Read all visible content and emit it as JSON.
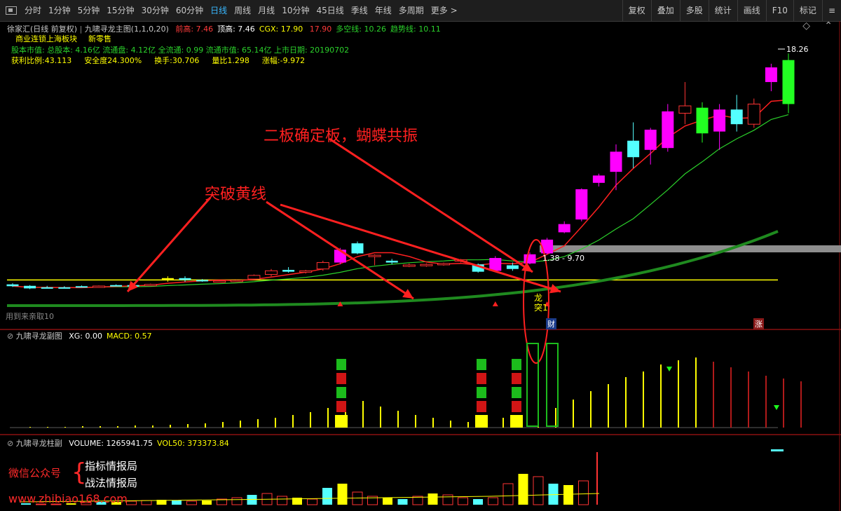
{
  "toolbar": {
    "items": [
      "分时",
      "1分钟",
      "5分钟",
      "15分钟",
      "30分钟",
      "60分钟",
      "日线",
      "周线",
      "月线",
      "10分钟",
      "45日线",
      "季线",
      "年线",
      "多周期",
      "更多 >"
    ],
    "active_index": 6,
    "right_items": [
      "复权",
      "叠加",
      "多股",
      "统计",
      "画线",
      "F10",
      "标记",
      "≡"
    ]
  },
  "main_panel": {
    "header": "徐家汇(日线 前复权)",
    "indicator_name": "九啸寻龙主图(1,1,0,20)",
    "fields": [
      {
        "label": "前高:",
        "value": "7.46",
        "color": "#ff3b3b"
      },
      {
        "label": "顶高:",
        "value": "7.46",
        "color": "#ffffff"
      },
      {
        "label": "CGX:",
        "value": "17.90",
        "color": "#ffff00"
      },
      {
        "label": "",
        "value": "17.90",
        "color": "#ff3b3b"
      },
      {
        "label": "多空线:",
        "value": "10.26",
        "color": "#2bd12b"
      },
      {
        "label": "趋势线:",
        "value": "10.11",
        "color": "#2bd12b"
      }
    ],
    "sector_line": [
      "商业连锁",
      "上海板块",
      "新零售"
    ],
    "stock_info": "股本市值: 总股本: 4.16亿 流通盘: 4.12亿 全流通: 0.99 流通市值: 65.14亿 上市日期: 20190702",
    "stats": [
      {
        "label": "获利比例:",
        "value": "43.113"
      },
      {
        "label": "安全度",
        "value": "24.300%"
      },
      {
        "label": "换手:",
        "value": "30.706"
      },
      {
        "label": "量比",
        "value": "1.298"
      },
      {
        "label": "涨幅:",
        "value": "-9.972"
      }
    ],
    "max_price_label": "18.26",
    "zone_label": "1.38 - 9.70",
    "watermark_text": "用到来亲取10",
    "marker_cai": "财",
    "marker_zhang": "涨",
    "vertical_text": [
      "龙",
      "突1"
    ]
  },
  "annotations": {
    "breakout": "突破黄线",
    "second_board": "二板确定板，蝴蝶共振"
  },
  "sub_panel": {
    "title": "九啸寻龙副图",
    "fields": [
      {
        "label": "XG:",
        "value": "0.00",
        "color": "#ffffff"
      },
      {
        "label": "MACD:",
        "value": "0.57",
        "color": "#ffff00"
      }
    ]
  },
  "volume_panel": {
    "title": "九啸寻龙柱副",
    "fields": [
      {
        "label": "VOLUME:",
        "value": "1265941.75",
        "color": "#ffffff"
      },
      {
        "label": "VOL50:",
        "value": "373373.84",
        "color": "#ffff00"
      }
    ]
  },
  "promo": {
    "account_label": "微信公众号",
    "names": [
      "指标情报局",
      "战法情报局"
    ],
    "url": "www.zhibiao168.com"
  },
  "chart_data": {
    "type": "candlestick",
    "price_range": [
      4.5,
      18.5
    ],
    "max_price": 18.26,
    "yellow_line": 5.9,
    "candles": [
      {
        "o": 5.66,
        "h": 5.72,
        "l": 5.52,
        "c": 5.56,
        "col": "#54ffff"
      },
      {
        "o": 5.58,
        "h": 5.62,
        "l": 5.4,
        "c": 5.44,
        "col": "#54ffff"
      },
      {
        "o": 5.5,
        "h": 5.58,
        "l": 5.44,
        "c": 5.48,
        "col": "#54ffff"
      },
      {
        "o": 5.5,
        "h": 5.56,
        "l": 5.44,
        "c": 5.46,
        "col": "#54ffff"
      },
      {
        "o": 5.56,
        "h": 5.6,
        "l": 5.5,
        "c": 5.54,
        "col": "#54ffff"
      },
      {
        "o": 5.55,
        "h": 5.6,
        "l": 5.52,
        "c": 5.57,
        "col": "#ff3333"
      },
      {
        "o": 5.6,
        "h": 5.66,
        "l": 5.56,
        "c": 5.62,
        "col": "#54ffff"
      },
      {
        "o": 5.62,
        "h": 5.68,
        "l": 5.58,
        "c": 5.6,
        "col": "#54ffff"
      },
      {
        "o": 5.64,
        "h": 5.7,
        "l": 5.6,
        "c": 5.66,
        "col": "#ff3333"
      },
      {
        "o": 5.9,
        "h": 6.1,
        "l": 5.8,
        "c": 6.0,
        "col": "#ffff00"
      },
      {
        "o": 6.0,
        "h": 6.1,
        "l": 5.8,
        "c": 5.9,
        "col": "#54ffff"
      },
      {
        "o": 5.9,
        "h": 5.95,
        "l": 5.8,
        "c": 5.86,
        "col": "#54ffff"
      },
      {
        "o": 5.85,
        "h": 5.9,
        "l": 5.8,
        "c": 5.82,
        "col": "#ff3333"
      },
      {
        "o": 5.86,
        "h": 5.92,
        "l": 5.82,
        "c": 5.88,
        "col": "#ff3333"
      },
      {
        "o": 5.95,
        "h": 6.2,
        "l": 5.9,
        "c": 6.15,
        "col": "#ff3333"
      },
      {
        "o": 6.2,
        "h": 6.5,
        "l": 6.1,
        "c": 6.4,
        "col": "#ff3333"
      },
      {
        "o": 6.45,
        "h": 6.6,
        "l": 6.3,
        "c": 6.35,
        "col": "#54ffff"
      },
      {
        "o": 6.35,
        "h": 6.45,
        "l": 6.25,
        "c": 6.4,
        "col": "#ff3333"
      },
      {
        "o": 6.5,
        "h": 6.95,
        "l": 6.4,
        "c": 6.85,
        "col": "#ff3333"
      },
      {
        "o": 6.85,
        "h": 7.65,
        "l": 6.75,
        "c": 7.55,
        "col": "#ff00ff"
      },
      {
        "o": 7.35,
        "h": 8.0,
        "l": 7.3,
        "c": 7.9,
        "col": "#54ffff"
      },
      {
        "o": 7.2,
        "h": 7.3,
        "l": 6.7,
        "c": 7.25,
        "col": "#ff3333"
      },
      {
        "o": 6.95,
        "h": 7.05,
        "l": 6.75,
        "c": 6.85,
        "col": "#54ffff"
      },
      {
        "o": 6.7,
        "h": 6.8,
        "l": 6.6,
        "c": 6.72,
        "col": "#ff3333"
      },
      {
        "o": 6.75,
        "h": 6.8,
        "l": 6.62,
        "c": 6.7,
        "col": "#ff3333"
      },
      {
        "o": 6.75,
        "h": 6.85,
        "l": 6.68,
        "c": 6.8,
        "col": "#ff3333"
      },
      {
        "o": 6.95,
        "h": 7.05,
        "l": 6.85,
        "c": 7.0,
        "col": "#ff3333"
      },
      {
        "o": 6.75,
        "h": 6.8,
        "l": 6.3,
        "c": 6.35,
        "col": "#54ffff"
      },
      {
        "o": 6.4,
        "h": 7.2,
        "l": 6.35,
        "c": 7.1,
        "col": "#ff00ff"
      },
      {
        "o": 6.5,
        "h": 6.85,
        "l": 6.4,
        "c": 6.7,
        "col": "#54ffff"
      },
      {
        "o": 6.8,
        "h": 7.4,
        "l": 6.75,
        "c": 7.3,
        "col": "#ff00ff"
      },
      {
        "o": 7.35,
        "h": 8.2,
        "l": 7.3,
        "c": 8.1,
        "col": "#ff00ff"
      },
      {
        "o": 8.5,
        "h": 9.1,
        "l": 8.45,
        "c": 8.95,
        "col": "#ff00ff"
      },
      {
        "o": 9.2,
        "h": 10.9,
        "l": 9.1,
        "c": 10.85,
        "col": "#ff00ff"
      },
      {
        "o": 11.2,
        "h": 11.7,
        "l": 11.0,
        "c": 11.6,
        "col": "#ff00ff"
      },
      {
        "o": 11.8,
        "h": 13.3,
        "l": 10.8,
        "c": 12.9,
        "col": "#ff00ff"
      },
      {
        "o": 13.5,
        "h": 14.5,
        "l": 12.0,
        "c": 12.6,
        "col": "#54ffff"
      },
      {
        "o": 13.0,
        "h": 14.2,
        "l": 12.2,
        "c": 14.1,
        "col": "#ff00ff"
      },
      {
        "o": 13.1,
        "h": 15.5,
        "l": 12.9,
        "c": 15.1,
        "col": "#ff00ff"
      },
      {
        "o": 15.0,
        "h": 16.7,
        "l": 14.4,
        "c": 15.4,
        "col": "#ff3333"
      },
      {
        "o": 15.3,
        "h": 15.6,
        "l": 13.4,
        "c": 13.9,
        "col": "#22ff22"
      },
      {
        "o": 14.0,
        "h": 15.5,
        "l": 13.0,
        "c": 15.2,
        "col": "#ff00ff"
      },
      {
        "o": 15.2,
        "h": 16.0,
        "l": 14.0,
        "c": 14.4,
        "col": "#54ffff"
      },
      {
        "o": 14.4,
        "h": 15.8,
        "l": 14.2,
        "c": 15.5,
        "col": "#ff3333"
      },
      {
        "o": 16.7,
        "h": 17.7,
        "l": 16.2,
        "c": 17.5,
        "col": "#ff00ff"
      },
      {
        "o": 17.9,
        "h": 18.26,
        "l": 15.0,
        "c": 15.5,
        "col": "#22ff22"
      }
    ]
  }
}
